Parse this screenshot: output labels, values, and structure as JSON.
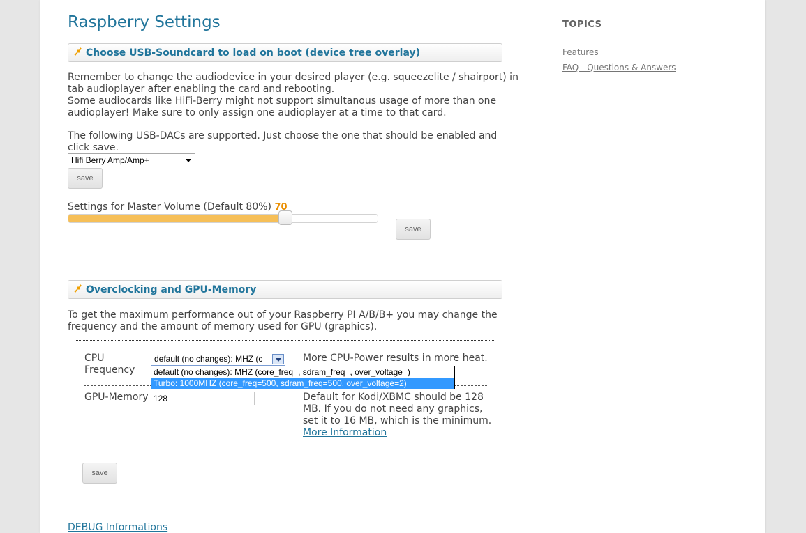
{
  "page_title": "Raspberry Settings",
  "soundcard": {
    "header": "Choose USB-Soundcard to load on boot (device tree overlay)",
    "intro_lines": [
      "Remember to change the audiodevice in your desired player (e.g. squeezelite / shairport) in",
      "tab audioplayer after enabling the card and rebooting.",
      "Some audiocards like HiFi-Berry might not support simultanous usage of more than one",
      "audioplayer! Make sure to only assign one audioplayer at a time to that card."
    ],
    "supported_lines": [
      "The following USB-DACs are supported. Just choose the one that should be enabled and",
      "click save."
    ],
    "selected_card": "Hifi Berry Amp/Amp+",
    "save_label": "save"
  },
  "volume": {
    "label": "Settings for Master Volume (Default 80%)",
    "value": 70,
    "value_label": "70",
    "max": 100,
    "save_label": "save"
  },
  "overclocking": {
    "header": "Overclocking and GPU-Memory",
    "intro_lines": [
      "To get the maximum performance out of your Raspberry PI A/B/B+ you may change the",
      "frequency and the amount of memory used for GPU (graphics)."
    ],
    "cpu_label_lines": [
      "CPU",
      "Frequency"
    ],
    "cpu_selected": "default (no changes): MHZ (c",
    "cpu_note": "More CPU-Power results in more heat.",
    "cpu_options": [
      "default (no changes): MHZ (core_freq=, sdram_freq=, over_voltage=)",
      "Turbo: 1000MHZ (core_freq=500, sdram_freq=500, over_voltage=2)"
    ],
    "cpu_highlighted_option_index": 1,
    "gpu_label": "GPU-Memory",
    "gpu_value": "128",
    "gpu_note_lines": [
      "Default for Kodi/XBMC should be 128",
      "MB. If you do not need any graphics,",
      "set it to 16 MB, which is the minimum."
    ],
    "more_info_label": "More Information",
    "save_label": "save"
  },
  "debug_label": "DEBUG Informations",
  "sidebar": {
    "title": "TOPICS",
    "links": [
      "Features",
      "FAQ - Questions & Answers"
    ]
  },
  "colors": {
    "accent": "#21759b",
    "slider_fill": "#f6bf58",
    "volume_value": "#eb8f00",
    "selection": "#3399ff"
  },
  "icons": {
    "section_header": "wrench-icon",
    "select_arrow": "chevron-down-icon"
  }
}
